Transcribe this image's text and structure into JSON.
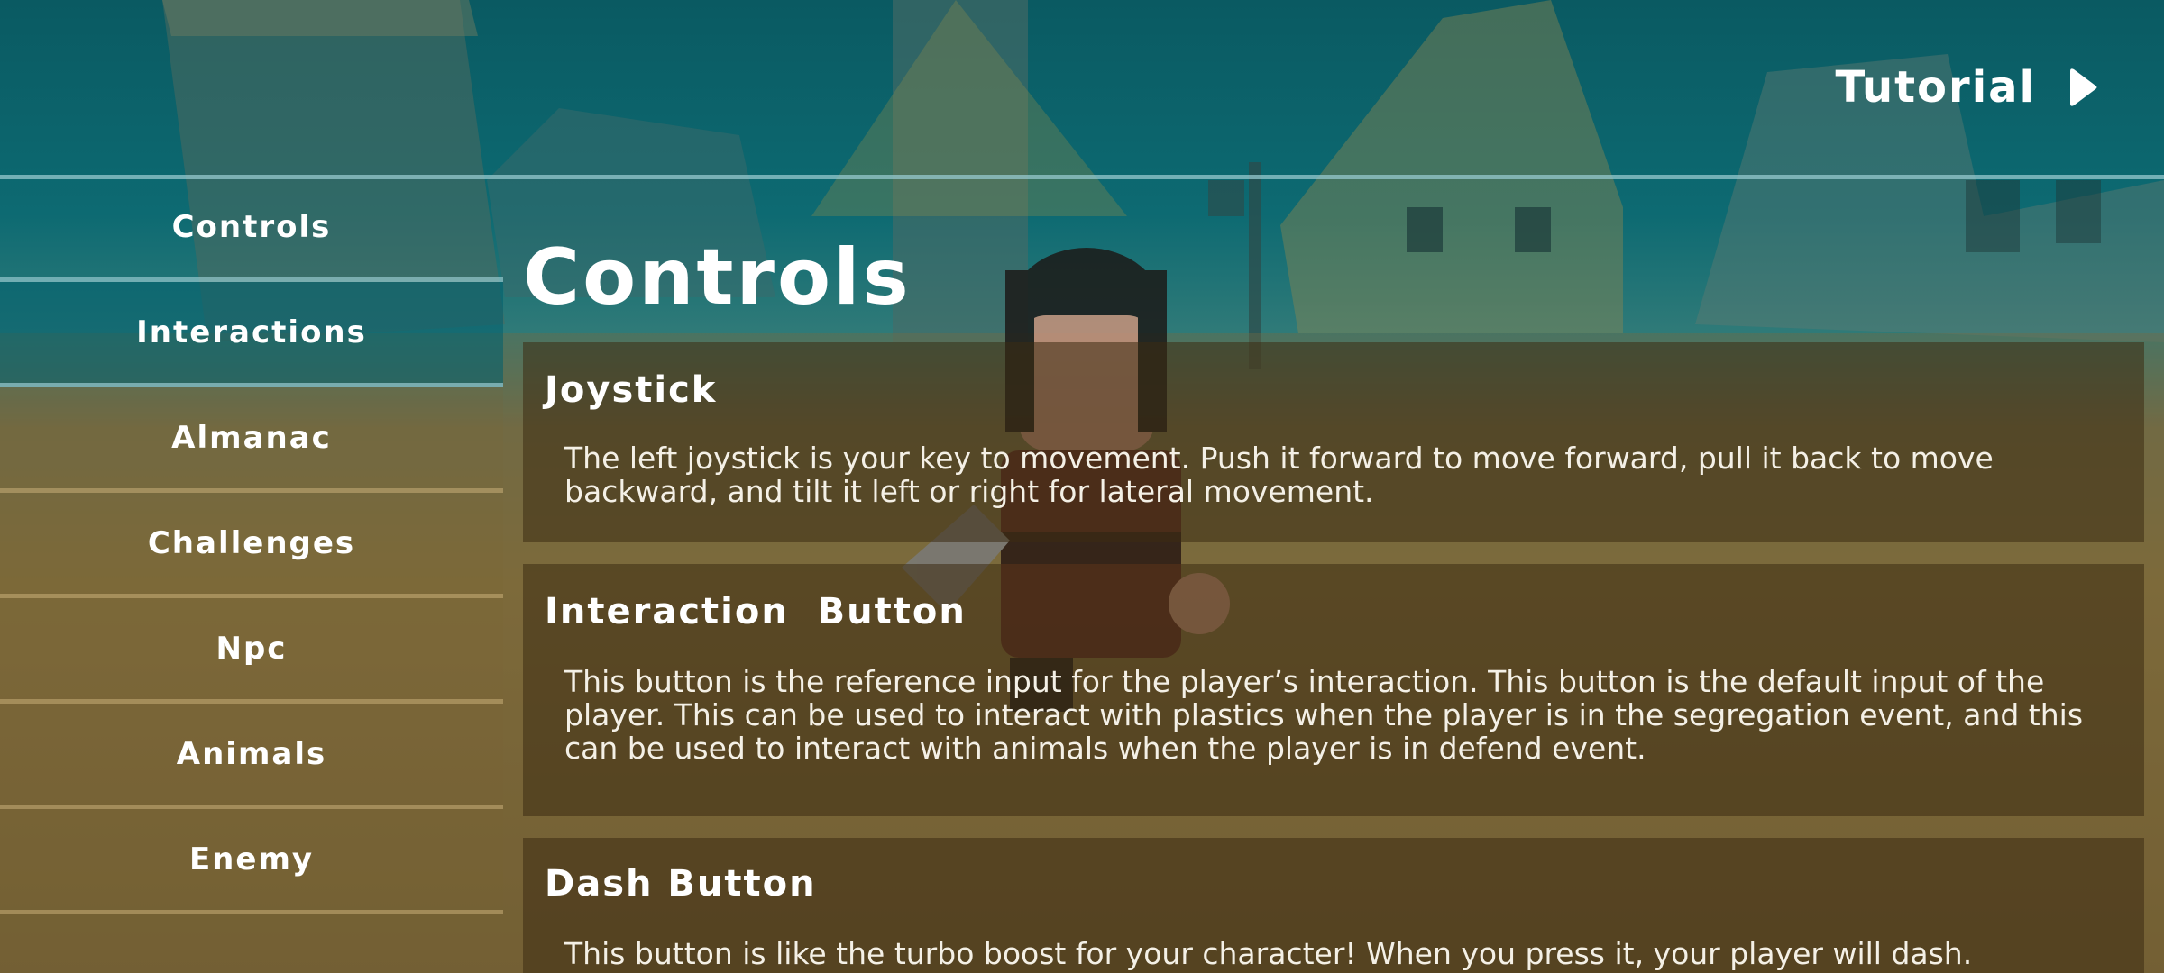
{
  "header": {
    "tutorial_label": "Tutorial",
    "tutorial_icon": "play-arrow-icon"
  },
  "sidebar": {
    "items": [
      {
        "label": "Controls"
      },
      {
        "label": "Interactions"
      },
      {
        "label": "Almanac"
      },
      {
        "label": "Challenges"
      },
      {
        "label": "Npc"
      },
      {
        "label": "Animals"
      },
      {
        "label": "Enemy"
      }
    ],
    "active_index": 1
  },
  "main": {
    "title": "Controls",
    "cards": [
      {
        "title": "Joystick",
        "body": "The left joystick is your key to movement. Push it forward to move forward, pull it back to move backward, and tilt it left or right for lateral movement."
      },
      {
        "title": "Interaction  Button",
        "body": "This button is the reference input for the player’s interaction. This button is the default input of the player. This can be used to interact with plastics when the player is in the segregation event, and this can be used to interact with animals when the player is in defend event."
      },
      {
        "title": "Dash Button",
        "body": "This button is like the turbo boost for your character! When you press it, your player will dash."
      }
    ]
  },
  "colors": {
    "sky_teal": "#0a5a62",
    "ground_brown": "#7e6a3a",
    "active_tab": "#005f6e",
    "divider": "#96c8cd"
  }
}
